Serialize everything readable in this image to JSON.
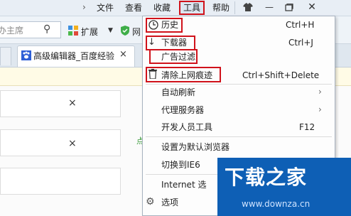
{
  "menubar": {
    "items": [
      {
        "label": "文件"
      },
      {
        "label": "查看"
      },
      {
        "label": "收藏"
      },
      {
        "label": "工具"
      },
      {
        "label": "帮助"
      }
    ]
  },
  "toolbar": {
    "search_placeholder": "办主席",
    "extension_label": "扩展",
    "shield_label": "网"
  },
  "tab": {
    "title": "高级编辑器_百度经验",
    "close": "×"
  },
  "content": {
    "row_close": "×",
    "partial_char": "点"
  },
  "menu": {
    "items": [
      {
        "label": "历史",
        "shortcut": "Ctrl+H"
      },
      {
        "label": "下载器",
        "shortcut": "Ctrl+J"
      },
      {
        "label": "广告过滤",
        "shortcut": ""
      },
      {
        "label": "清除上网痕迹",
        "shortcut": "Ctrl+Shift+Delete"
      },
      {
        "label": "自动刷新",
        "shortcut": ""
      },
      {
        "label": "代理服务器",
        "shortcut": ""
      },
      {
        "label": "开发人员工具",
        "shortcut": "F12"
      },
      {
        "label": "设置为默认浏览器",
        "shortcut": ""
      },
      {
        "label": "切换到IE6",
        "shortcut": ""
      },
      {
        "label": "Internet 选",
        "shortcut": ""
      },
      {
        "label": "选项",
        "shortcut": ""
      }
    ]
  },
  "watermark": {
    "main": "下载之家",
    "sub": "www.downza.cn"
  },
  "colors": {
    "highlight": "#d0121b",
    "watermark_bg": "#0e5fb5"
  }
}
